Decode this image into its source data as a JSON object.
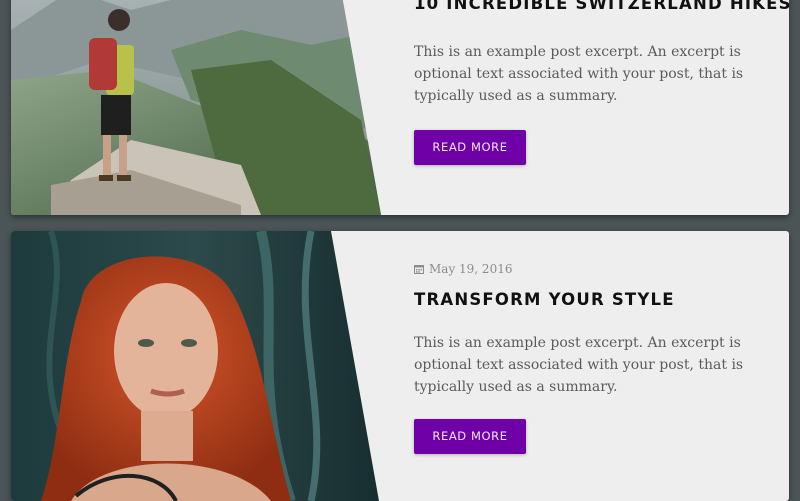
{
  "posts": [
    {
      "image_alt": "Hiker with red backpack on a mountain ridge",
      "title": "10 Incredible Switzerland Hikes",
      "excerpt": "This is an example post excerpt. An excerpt is optional text associated with your post, that is typically used as a summary.",
      "button_label": "READ MORE"
    },
    {
      "image_alt": "Red-haired woman portrait in a forest",
      "date_icon": "calendar-icon",
      "date": "May 19, 2016",
      "title": "Transform Your Style",
      "excerpt": "This is an example post excerpt. An excerpt is optional text associated with your post, that is typically used as a summary.",
      "button_label": "READ MORE"
    }
  ],
  "colors": {
    "background": "#4b5557",
    "card": "#eeeeee",
    "accent_button": "#6f00a8"
  }
}
